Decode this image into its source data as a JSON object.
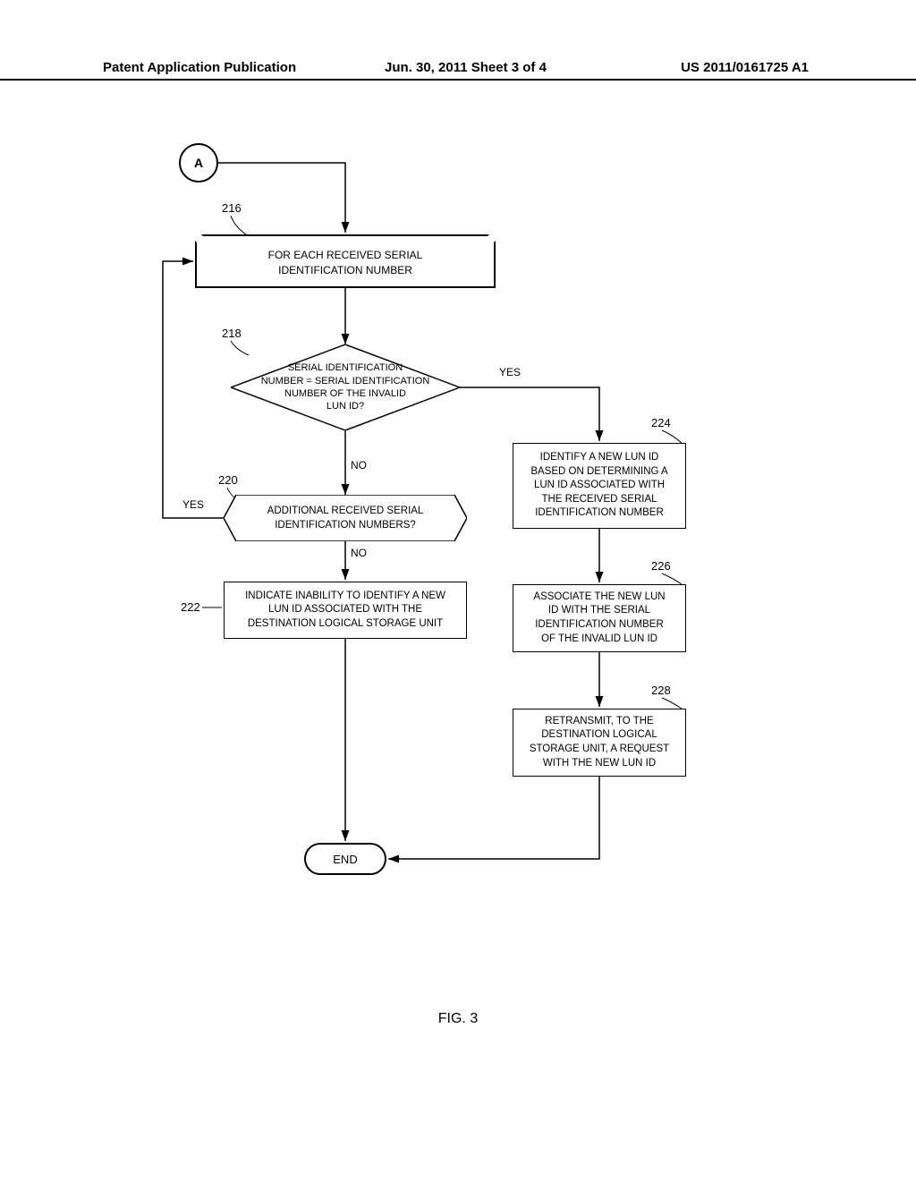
{
  "header": {
    "left": "Patent Application Publication",
    "mid": "Jun. 30, 2011  Sheet 3 of 4",
    "right": "US 2011/0161725 A1"
  },
  "nodes": {
    "A": "A",
    "loop216": "FOR EACH RECEIVED SERIAL\nIDENTIFICATION NUMBER",
    "d218": "SERIAL IDENTIFICATION\nNUMBER = SERIAL IDENTIFICATION\nNUMBER OF THE INVALID\nLUN ID?",
    "hex220": "ADDITIONAL RECEIVED SERIAL\nIDENTIFICATION NUMBERS?",
    "r222": "INDICATE INABILITY TO IDENTIFY A NEW\nLUN ID ASSOCIATED WITH THE\nDESTINATION LOGICAL STORAGE UNIT",
    "r224": "IDENTIFY A NEW LUN ID\nBASED ON DETERMINING A\nLUN ID ASSOCIATED WITH\nTHE RECEIVED SERIAL\nIDENTIFICATION NUMBER",
    "r226": "ASSOCIATE THE NEW LUN\nID WITH THE SERIAL\nIDENTIFICATION NUMBER\nOF THE INVALID LUN ID",
    "r228": "RETRANSMIT, TO THE\nDESTINATION LOGICAL\nSTORAGE UNIT, A REQUEST\nWITH THE NEW LUN ID",
    "end": "END"
  },
  "refs": {
    "r216": "216",
    "r218": "218",
    "r220": "220",
    "r222": "222",
    "r224": "224",
    "r226": "226",
    "r228": "228"
  },
  "labels": {
    "yes_d": "YES",
    "no_d": "NO",
    "yes_h": "YES",
    "no_h": "NO"
  },
  "figure": "FIG. 3"
}
